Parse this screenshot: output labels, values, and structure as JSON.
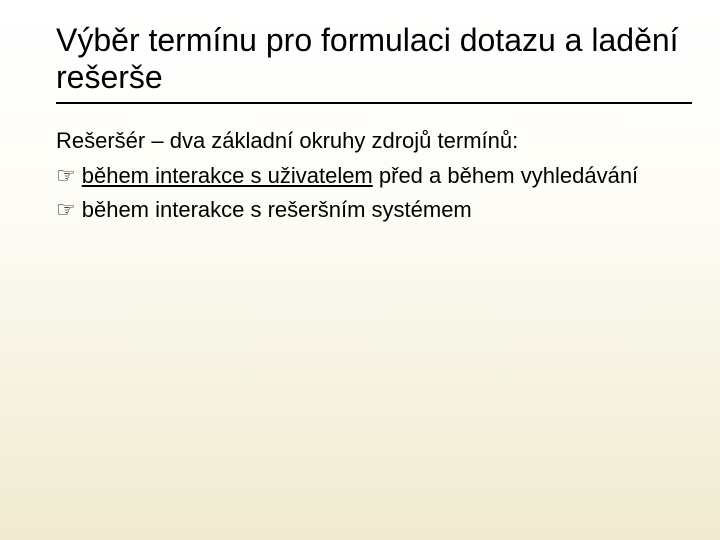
{
  "title": "Výběr termínu pro formulaci dotazu a ladění rešerše",
  "intro": "Rešeršér – dva základní okruhy zdrojů termínů:",
  "bullet_icon": "☞",
  "bullets": [
    {
      "ul": "během interakce s uživatelem",
      "rest": " před a během vyhledávání"
    },
    {
      "ul": "",
      "rest": "během interakce s rešeršním systémem"
    }
  ]
}
